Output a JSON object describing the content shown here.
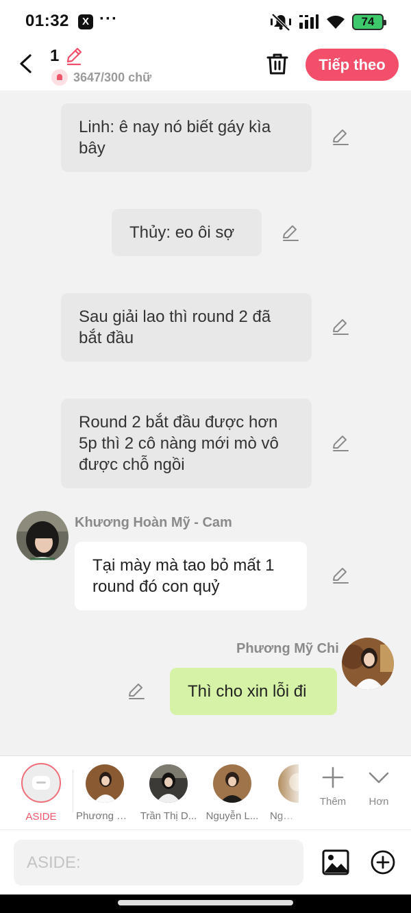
{
  "status_bar": {
    "time": "01:32",
    "x_app": "X",
    "more": "···",
    "battery": "74"
  },
  "header": {
    "title": "1",
    "count": "3647/300 chữ",
    "next_label": "Tiếp theo"
  },
  "messages": [
    {
      "text": "Linh: ê nay nó biết gáy kìa bây"
    },
    {
      "text": "Thủy: eo ôi sợ"
    },
    {
      "text": "Sau giải lao thì round 2 đã bắt đầu"
    },
    {
      "text": "Round 2 bắt đầu được hơn 5p thì 2 cô nàng mới mò vô được chỗ ngồi"
    },
    {
      "sender": "Khương Hoàn Mỹ - Cam",
      "text": "Tại mày mà tao bỏ mất 1 round đó con quỷ"
    },
    {
      "sender": "Phương Mỹ Chi",
      "text": "Thì cho xin lỗi đi"
    }
  ],
  "tray": {
    "aside_label": "ASIDE",
    "characters": [
      {
        "label": "Phương M..."
      },
      {
        "label": "Trần Thị D..."
      },
      {
        "label": "Nguyễn L..."
      },
      {
        "label": "Nguyễ"
      }
    ],
    "add_label": "Thêm",
    "more_label": "Hơn"
  },
  "input": {
    "placeholder": "ASIDE:"
  },
  "colors": {
    "accent": "#f34f6b",
    "green_bubble": "#d5f2a6",
    "grey_bubble": "#e8e8e8"
  }
}
